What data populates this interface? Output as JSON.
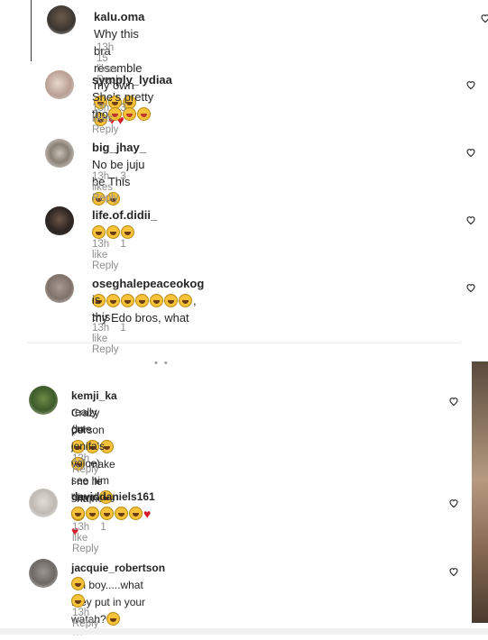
{
  "comments": [
    {
      "user": "kalu.oma",
      "text": "Why this bra resemble my own",
      "time": "13h",
      "likes": "15 likes",
      "reply": "Reply"
    },
    {
      "user": "symply_lydiaa",
      "text": "She's pretty tho",
      "time": "13h",
      "likes": "3 likes",
      "reply": "Reply"
    },
    {
      "user": "big_jhay_",
      "text": "No be juju be This",
      "time": "13h",
      "likes": "3 likes",
      "reply": "Reply"
    },
    {
      "user": "life.of.didii_",
      "text": "",
      "time": "13h",
      "likes": "1 like",
      "reply": "Reply"
    },
    {
      "user": "oseghalepeaceokog",
      "text": ", my Edo bros, what",
      "text2": "is this",
      "time": "13h",
      "likes": "1 like",
      "reply": "Reply"
    },
    {
      "user": "kemji_ka",
      "text": "Crazy person",
      "text_b": "make i no lie sha he is",
      "text2": "really cute",
      "text3": "(In jenifa's voice) see him \"limp\"",
      "time": "13h",
      "reply": "Reply"
    },
    {
      "user": "daviddaniels161",
      "text": "",
      "time": "13h",
      "likes": "1 like",
      "reply": "Reply"
    },
    {
      "user": "jacquie_robertson",
      "text": "Oh boy.....what they put in your watah?",
      "time": "13h",
      "reply": "Reply",
      "more": "•••"
    }
  ],
  "colors": {
    "accent_heart": "#d81b2b",
    "emoji": "#f5c23a",
    "muted": "#8e8e8e"
  },
  "icons": [
    "heart-outline-icon",
    "laughing-emoji-icon",
    "star-eyes-emoji-icon",
    "red-heart-emoji-icon",
    "more-options-icon"
  ]
}
